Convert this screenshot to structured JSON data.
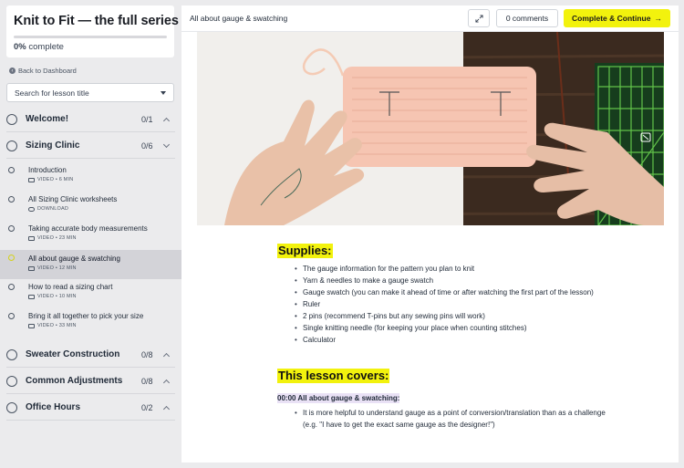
{
  "course": {
    "title": "Knit to Fit — the full series",
    "progress_percent": 0,
    "progress_value": "0%",
    "progress_suffix": " complete"
  },
  "nav": {
    "back_label": "Back to Dashboard",
    "search_placeholder": "Search for lesson title"
  },
  "sections": [
    {
      "title": "Welcome!",
      "count": "0/1",
      "expanded": false
    },
    {
      "title": "Sizing Clinic",
      "count": "0/6",
      "expanded": true
    },
    {
      "title": "Sweater Construction",
      "count": "0/8",
      "expanded": false
    },
    {
      "title": "Common Adjustments",
      "count": "0/8",
      "expanded": false
    },
    {
      "title": "Office Hours",
      "count": "0/2",
      "expanded": false
    }
  ],
  "lessons": [
    {
      "title": "Introduction",
      "meta": "VIDEO • 6 MIN",
      "icon": "video-icon"
    },
    {
      "title": "All Sizing Clinic worksheets",
      "meta": "DOWNLOAD",
      "icon": "download-icon"
    },
    {
      "title": "Taking accurate body measurements",
      "meta": "VIDEO • 23 MIN",
      "icon": "video-icon"
    },
    {
      "title": "All about gauge & swatching",
      "meta": "VIDEO • 12 MIN",
      "icon": "video-icon",
      "active": true
    },
    {
      "title": "How to read a sizing chart",
      "meta": "VIDEO • 10 MIN",
      "icon": "video-icon"
    },
    {
      "title": "Bring it all together to pick your size",
      "meta": "VIDEO • 33 MIN",
      "icon": "video-icon"
    }
  ],
  "header": {
    "lesson_title": "All about gauge & swatching",
    "comments_label": "0 comments",
    "complete_label": "Complete & Continue",
    "complete_arrow": "→"
  },
  "content": {
    "supplies_heading": "Supplies:",
    "supplies": [
      "The gauge information for the pattern you plan to knit",
      "Yarn & needles to make a gauge swatch",
      "Gauge swatch (you can make it ahead of time or after watching the first part of the lesson)",
      "Ruler",
      "2 pins (recommend T-pins but any sewing pins will work)",
      "Single knitting needle (for keeping your place when counting stitches)",
      "Calculator"
    ],
    "covers_heading": "This lesson covers:",
    "timestamp_label": "00:00 All about gauge & swatching:",
    "covers_points": [
      "It is more helpful to understand gauge as a point of conversion/translation than as a challenge (e.g. \"I have to get the exact same gauge as the designer!\")"
    ]
  },
  "colors": {
    "accent_yellow": "#f2f20d",
    "timestamp_highlight": "#e9e1f5",
    "sidebar_bg": "#ebebed",
    "active_lesson_bg": "#d3d3d8"
  }
}
